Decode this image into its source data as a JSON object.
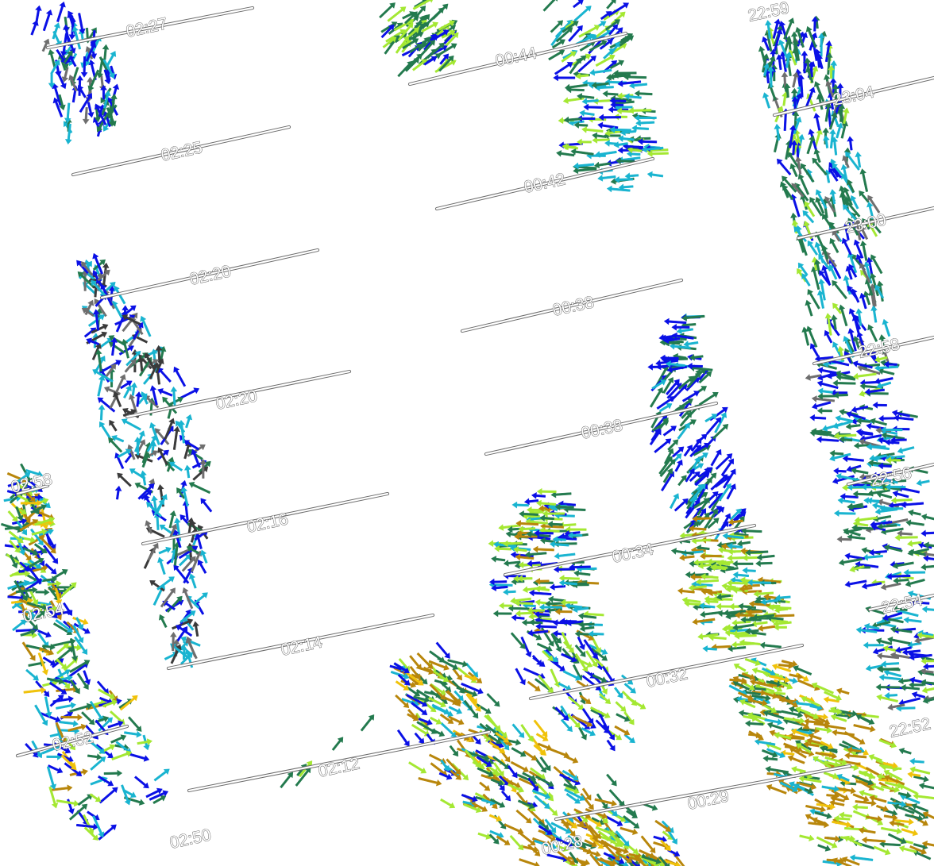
{
  "map_title": "",
  "arrow_colors": {
    "blue": "#0a10e6",
    "cyan": "#19b4d0",
    "darkgreen": "#237a4e",
    "lime": "#a4e832",
    "gold": "#b8860b",
    "yellow": "#f0c20a",
    "gray": "#6e6e6e",
    "darkgray": "#3a3a3a"
  },
  "tracks": [
    {
      "id": "pass-a",
      "labels": [
        "02:27",
        "02:25",
        "02:20",
        "02:20",
        "02:16",
        "02:14",
        "02:12"
      ]
    },
    {
      "id": "pass-b",
      "labels": [
        "00:44",
        "00:42",
        "00:38",
        "00:38",
        "00:34",
        "00:32",
        "00:29",
        "00:28"
      ]
    },
    {
      "id": "pass-c",
      "labels": [
        "23:04",
        "23:00",
        "22:58",
        "22:56",
        "22:54",
        "22:52",
        "22:59"
      ]
    },
    {
      "id": "pass-d",
      "labels": [
        "02:58",
        "02:54",
        "02:52",
        "02:50"
      ]
    }
  ]
}
